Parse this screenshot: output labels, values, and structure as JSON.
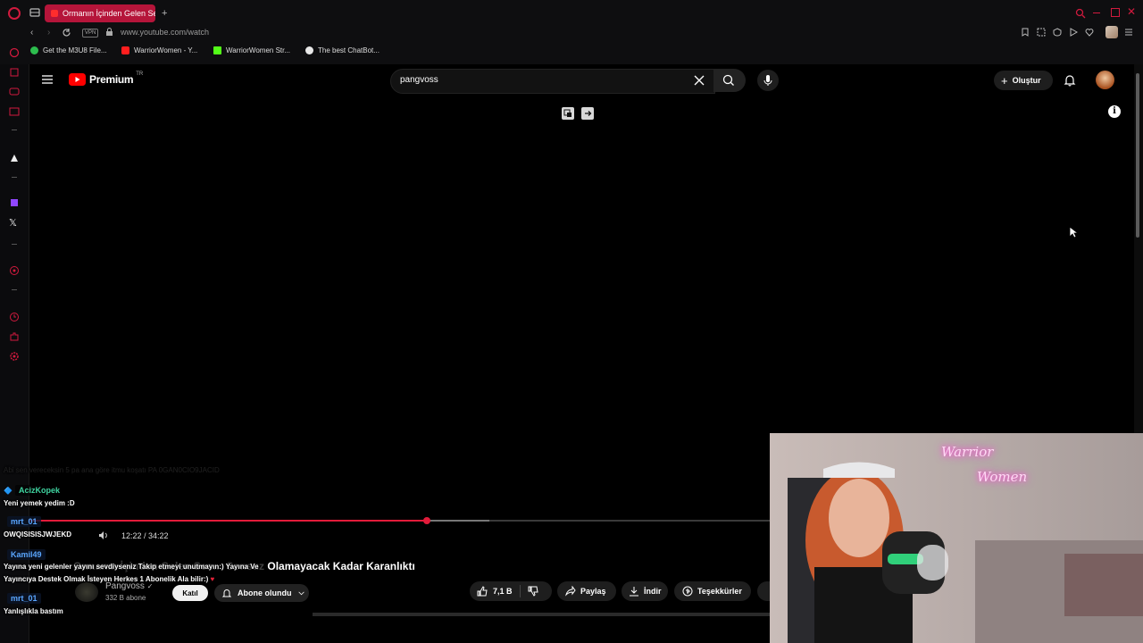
{
  "browser": {
    "tab_title": "Ormanın İçinden Gelen Se",
    "url": "www.youtube.com/watch",
    "vpn_label": "VPN",
    "bookmarks": [
      {
        "label": "Get the M3U8 File...",
        "color": "#2dbd4e"
      },
      {
        "label": "WarriorWomen - Y...",
        "color": "#ff1e1e"
      },
      {
        "label": "WarriorWomen Str...",
        "color": "#53fc18"
      },
      {
        "label": "The best ChatBot...",
        "color": "#e8e8e8"
      }
    ],
    "accent": "#b5153a"
  },
  "youtube": {
    "logo_text": "Premium",
    "logo_region": "TR",
    "search_value": "pangvoss",
    "create_label": "Oluştur",
    "video_title": "Ormanın İçinden Gelen Ses… Sonsuz Olamayacak Kadar Karanlıktı",
    "video_title_visible": "Olamayacak Kadar Karanlıktı",
    "channel_name": "Pangvoss",
    "subscribers": "332 B abone",
    "join_label": "Katıl",
    "subscribed_label": "Abone olundu",
    "likes": "7,1 B",
    "share_label": "Paylaş",
    "download_label": "İndir",
    "thanks_label": "Teşekkürler",
    "time": "12:22 / 34:22",
    "progress_fraction": 0.537
  },
  "chat": {
    "faded_line": "Abi sen vereceksin 5 pa ana göre itmu koşatı PA 0GAN0CIO9JACID",
    "messages": [
      {
        "user": "AcizKopek",
        "user_color": "#3fd4a0",
        "text": "Yeni yemek yedim :D"
      },
      {
        "user": "mrt_01",
        "user_color": "#5aa6ff",
        "text": "OWQISISISJWJEKD"
      },
      {
        "user": "Kamil49",
        "user_color": "#5aa6ff",
        "text": "Yayına yeni gelenler yayını sevdiyseniz Takip etmeyi unutmayın:) Yayına Ve"
      },
      {
        "user": "",
        "user_color": "",
        "text": "Yayıncıya Destek Olmak İsteyen Herkes 1 Abonelik Ala bilir:)"
      },
      {
        "user": "mrt_01",
        "user_color": "#5aa6ff",
        "text": "Yanlışlıkla bastım"
      }
    ]
  },
  "webcam": {
    "neon_line1": "Warrior",
    "neon_line2": "Women"
  }
}
